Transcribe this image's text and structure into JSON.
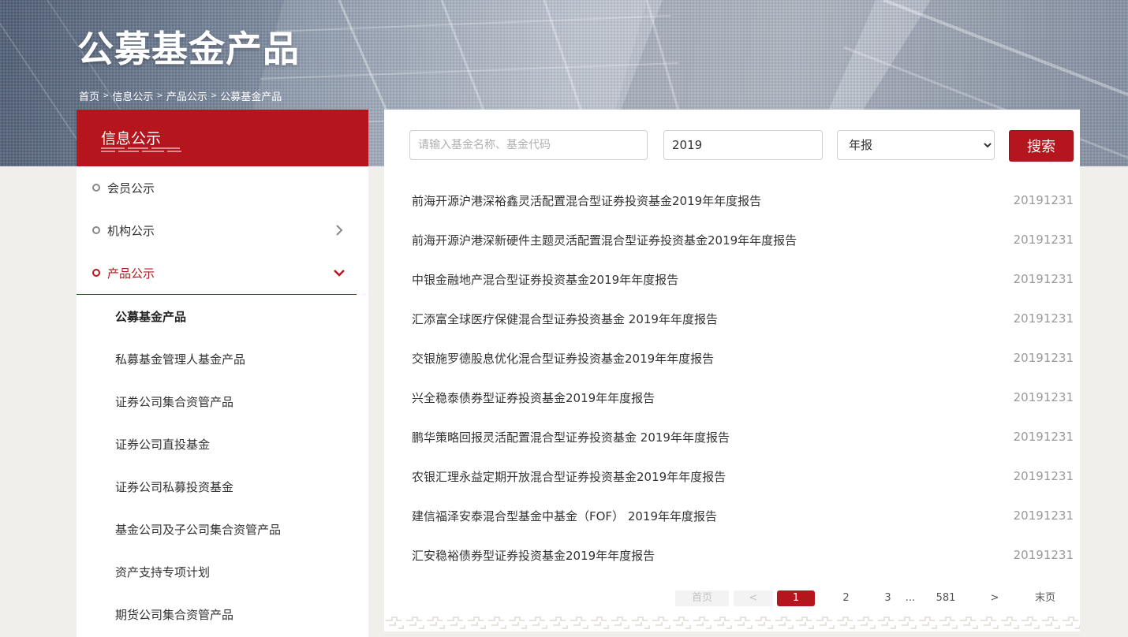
{
  "header": {
    "title": "公募基金产品",
    "breadcrumb": [
      "首页",
      "信息公示",
      "产品公示",
      "公募基金产品"
    ],
    "breadcrumb_sep": ">"
  },
  "sidebar": {
    "title": "信息公示",
    "menu": [
      {
        "label": "会员公示",
        "active": false
      },
      {
        "label": "机构公示",
        "active": false,
        "icon": "chevron-right-icon"
      },
      {
        "label": "产品公示",
        "active": true,
        "icon": "chevron-down-icon"
      }
    ],
    "submenu": [
      {
        "label": "公募基金产品",
        "current": true
      },
      {
        "label": "私募基金管理人基金产品"
      },
      {
        "label": "证券公司集合资管产品"
      },
      {
        "label": "证券公司直投基金"
      },
      {
        "label": "证券公司私募投资基金"
      },
      {
        "label": "基金公司及子公司集合资管产品"
      },
      {
        "label": "资产支持专项计划"
      },
      {
        "label": "期货公司集合资管产品"
      }
    ]
  },
  "search": {
    "placeholder": "请输入基金名称、基金代码",
    "year_value": "2019",
    "type_selected": "年报",
    "button_label": "搜索"
  },
  "reports": [
    {
      "title": "前海开源沪港深裕鑫灵活配置混合型证券投资基金2019年年度报告",
      "date": "20191231"
    },
    {
      "title": "前海开源沪港深新硬件主题灵活配置混合型证券投资基金2019年年度报告",
      "date": "20191231"
    },
    {
      "title": "中银金融地产混合型证券投资基金2019年年度报告",
      "date": "20191231"
    },
    {
      "title": "汇添富全球医疗保健混合型证券投资基金 2019年年度报告",
      "date": "20191231"
    },
    {
      "title": "交银施罗德股息优化混合型证券投资基金2019年年度报告",
      "date": "20191231"
    },
    {
      "title": "兴全稳泰债券型证券投资基金2019年年度报告",
      "date": "20191231"
    },
    {
      "title": "鹏华策略回报灵活配置混合型证券投资基金 2019年年度报告",
      "date": "20191231"
    },
    {
      "title": "农银汇理永益定期开放混合型证券投资基金2019年年度报告",
      "date": "20191231"
    },
    {
      "title": "建信福泽安泰混合型基金中基金（FOF） 2019年年度报告",
      "date": "20191231"
    },
    {
      "title": "汇安稳裕债券型证券投资基金2019年年度报告",
      "date": "20191231"
    }
  ],
  "pagination": {
    "first": "首页",
    "prev": "<",
    "pages": [
      "1",
      "2",
      "3"
    ],
    "ellipsis": "...",
    "last_page": "581",
    "next": ">",
    "last": "末页",
    "current": 1
  },
  "colors": {
    "accent": "#b5161e",
    "date_text": "#999999",
    "background": "#f1efeb"
  }
}
